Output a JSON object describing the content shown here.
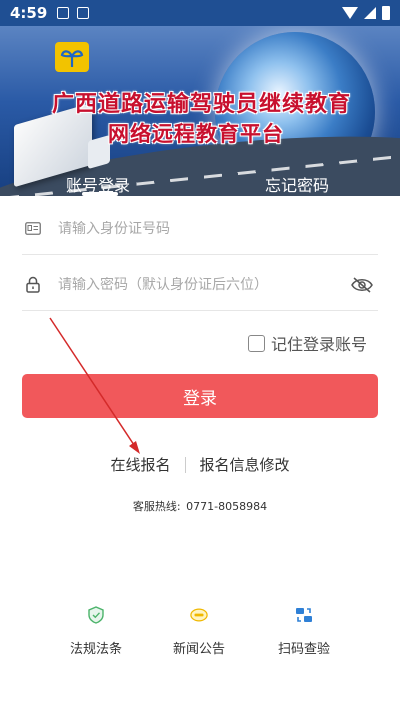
{
  "status_bar": {
    "time": "4:59"
  },
  "banner": {
    "logo_icon": "tree-logo",
    "title_line1": "广西道路运输驾驶员继续教育",
    "title_line2": "网络远程教育平台",
    "tabs": [
      {
        "label": "账号登录",
        "active": true
      },
      {
        "label": "忘记密码",
        "active": false
      }
    ]
  },
  "form": {
    "id_placeholder": "请输入身份证号码",
    "password_placeholder": "请输入密码（默认身份证后六位）",
    "remember_label": "记住登录账号",
    "login_label": "登录"
  },
  "links": {
    "register": "在线报名",
    "modify": "报名信息修改"
  },
  "hotline": {
    "label": "客服热线:",
    "number": "0771-8058984"
  },
  "bottom_nav": [
    {
      "label": "法规法条",
      "icon": "shield-icon"
    },
    {
      "label": "新闻公告",
      "icon": "news-icon"
    },
    {
      "label": "扫码查验",
      "icon": "scan-icon"
    }
  ],
  "colors": {
    "accent": "#f1585b",
    "header": "#1f4f93",
    "arrow": "#d42a2a"
  }
}
